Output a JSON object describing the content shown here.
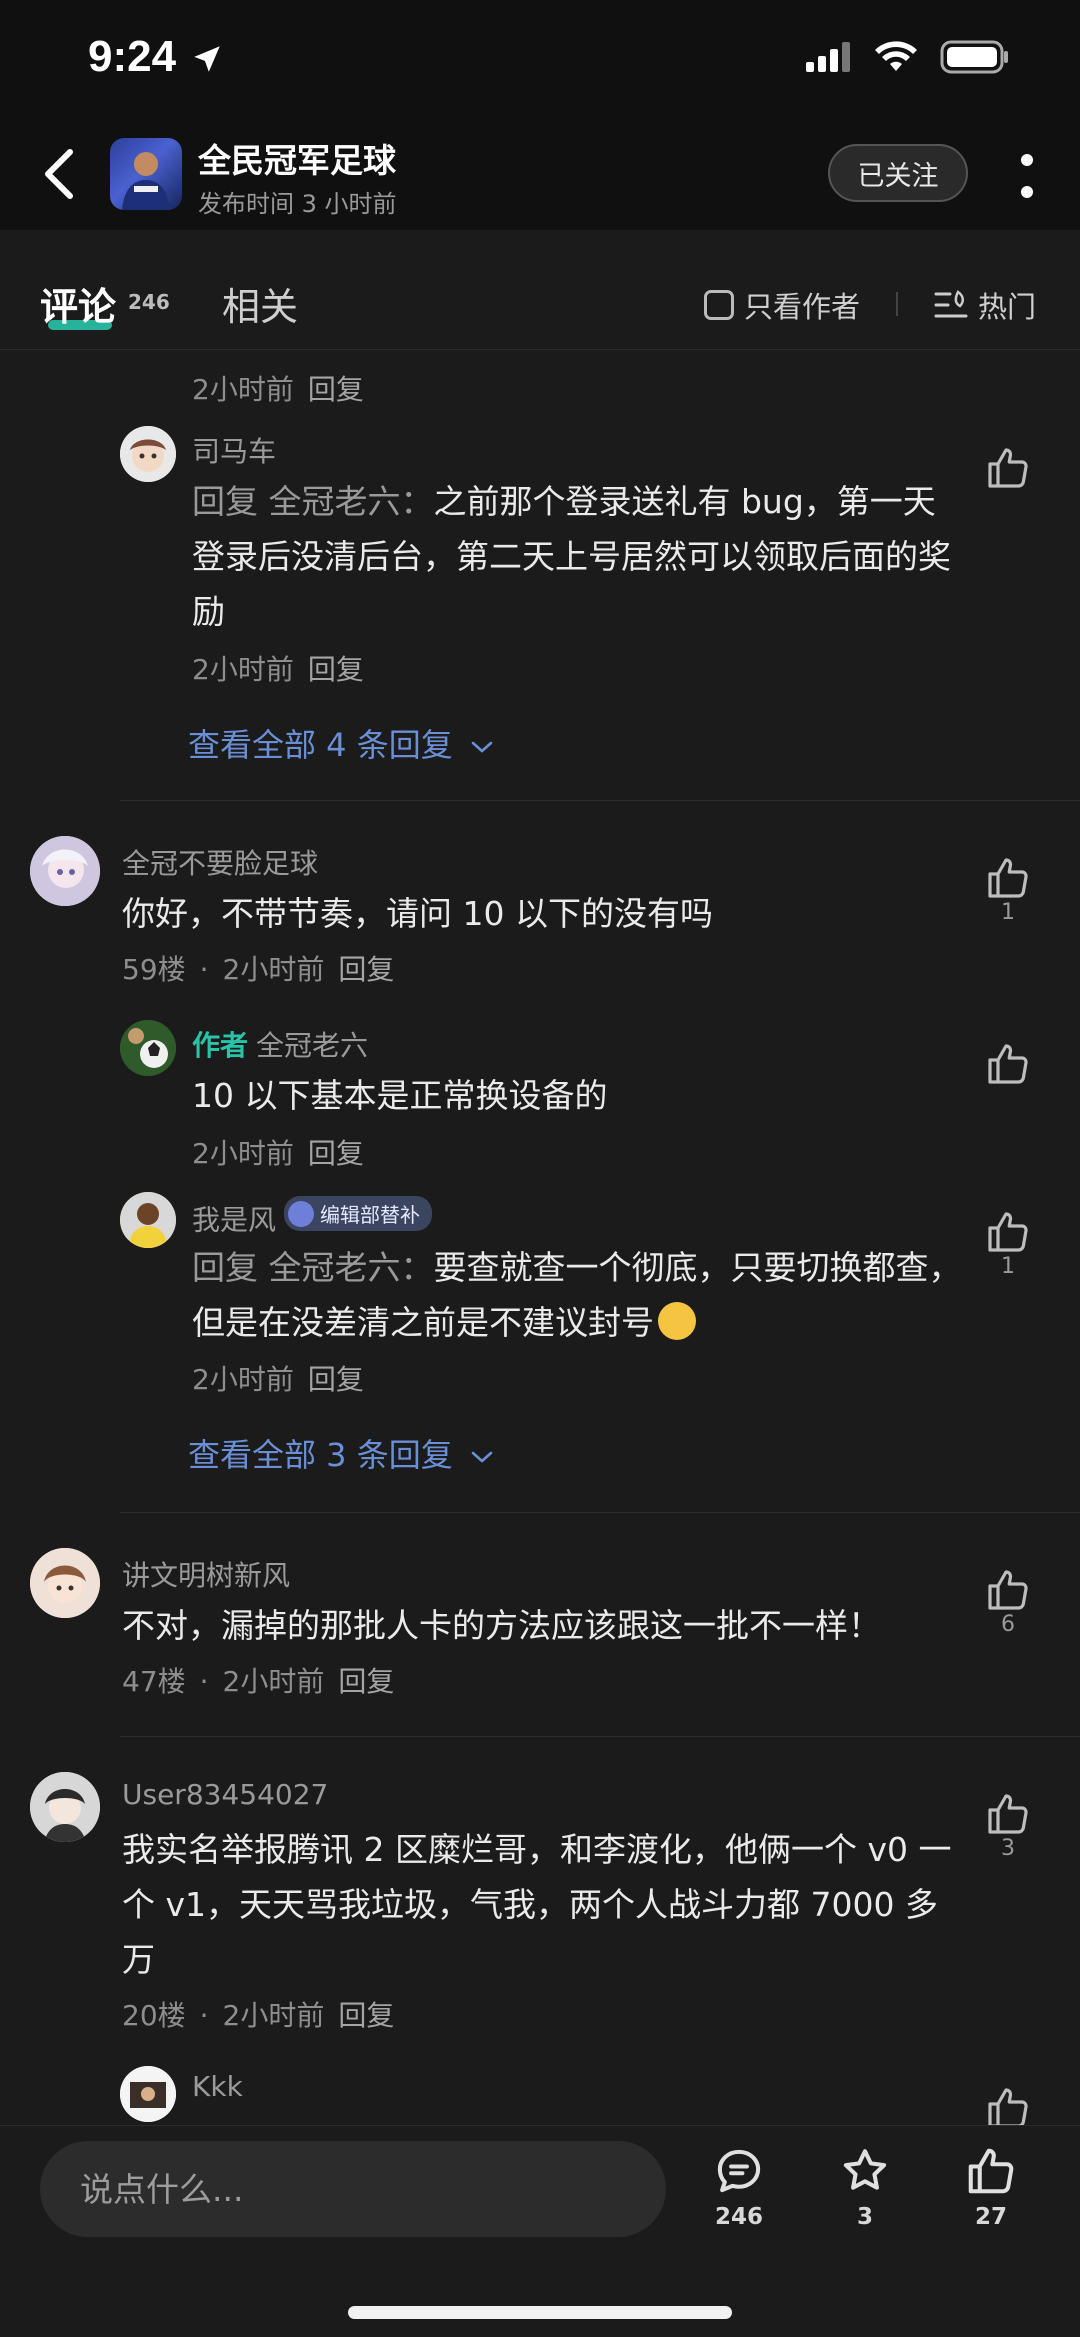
{
  "status_bar": {
    "time": "9:24"
  },
  "header": {
    "account_name": "全民冠军足球",
    "subtitle": "发布时间 3 小时前",
    "follow_label": "已关注"
  },
  "tabs": {
    "comments_label": "评论",
    "comments_count": "246",
    "related_label": "相关",
    "only_author_label": "只看作者",
    "sort_label": "热门"
  },
  "comments": {
    "top_meta": {
      "time": "2小时前",
      "reply": "回复"
    },
    "reply_simache": {
      "name": "司马车",
      "reply_prefix": "回复 全冠老六：",
      "text": "之前那个登录送礼有 bug，第一天登录后没清后台，第二天上号居然可以领取后面的奖励",
      "time": "2小时前",
      "reply": "回复"
    },
    "expand_1": "查看全部 4 条回复",
    "c59": {
      "name": "全冠不要脸足球",
      "text": "你好，不带节奏，请问 10 以下的没有吗",
      "floor": "59楼",
      "time": "2小时前",
      "reply": "回复",
      "likes": "1"
    },
    "c59_reply_author": {
      "tag": "作者",
      "name": "全冠老六",
      "text": "10 以下基本是正常换设备的",
      "time": "2小时前",
      "reply": "回复"
    },
    "c59_reply_feng": {
      "name": "我是风",
      "badge": "编辑部替补",
      "reply_prefix": "回复 全冠老六：",
      "text": "要查就查一个彻底，只要切换都查，但是在没差清之前是不建议封号",
      "time": "2小时前",
      "reply": "回复",
      "likes": "1"
    },
    "expand_2": "查看全部 3 条回复",
    "c47": {
      "name": "讲文明树新风",
      "text": "不对，漏掉的那批人卡的方法应该跟这一批不一样！",
      "floor": "47楼",
      "time": "2小时前",
      "reply": "回复",
      "likes": "6"
    },
    "c20": {
      "name": "User83454027",
      "text": "我实名举报腾讯 2 区糜烂哥，和李渡化，他俩一个 v0 一个 v1，天天骂我垃圾，气我，两个人战斗力都 7000 多万",
      "floor": "20楼",
      "time": "2小时前",
      "reply": "回复",
      "likes": "3"
    },
    "c20_reply_kkk": {
      "name": "Kkk"
    }
  },
  "bottom_bar": {
    "input_placeholder": "说点什么...",
    "comment_count": "246",
    "favorite_count": "3",
    "like_count": "27"
  },
  "colors": {
    "accent": "#29c4a8",
    "link": "#6b8fd6",
    "background": "#1b1b1b"
  }
}
